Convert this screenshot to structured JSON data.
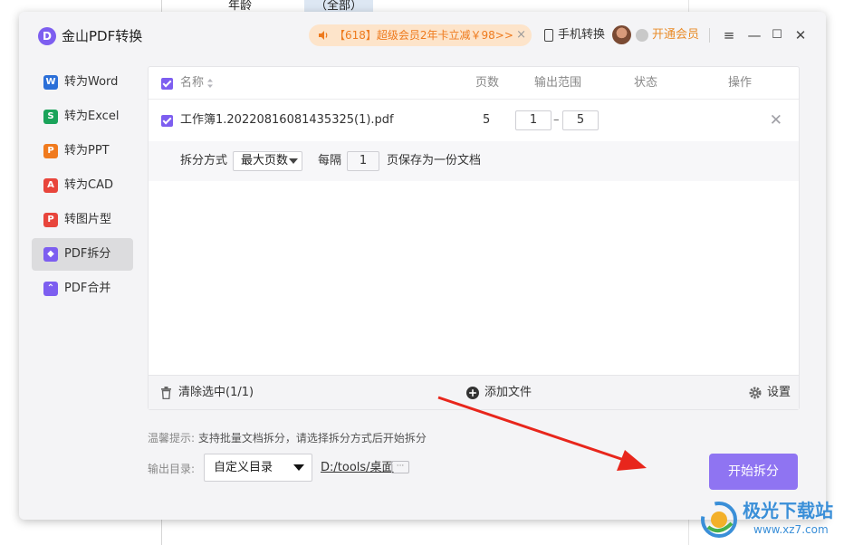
{
  "background": {
    "cell_age": "年龄",
    "cell_all": "（全部）"
  },
  "titlebar": {
    "app_title": "金山PDF转换",
    "logo_letter": "D",
    "promo_text": "【618】超级会员2年卡立减￥98>>",
    "promo_close": "×",
    "phone_label": "手机转换",
    "vip_label": "开通会员",
    "menu_icon": "≡",
    "minimize_icon": "—",
    "maximize_icon": "☐",
    "close_icon": "✕"
  },
  "sidebar": {
    "items": [
      {
        "label": "转为Word",
        "icon": "word-icon",
        "glyph": "W",
        "color": "#2b6fd8"
      },
      {
        "label": "转为Excel",
        "icon": "excel-icon",
        "glyph": "S",
        "color": "#1aa35a"
      },
      {
        "label": "转为PPT",
        "icon": "ppt-icon",
        "glyph": "P",
        "color": "#f07a1e"
      },
      {
        "label": "转为CAD",
        "icon": "cad-icon",
        "glyph": "A",
        "color": "#e8453c"
      },
      {
        "label": "转图片型PDF",
        "icon": "image-pdf-icon",
        "glyph": "P",
        "color": "#e8453c"
      },
      {
        "label": "PDF拆分",
        "icon": "split-icon",
        "glyph": "◆",
        "color": "#7d5ef0",
        "active": true
      },
      {
        "label": "PDF合并",
        "icon": "merge-icon",
        "glyph": "⌃",
        "color": "#7d5ef0"
      }
    ]
  },
  "table": {
    "headers": {
      "name": "名称",
      "pages": "页数",
      "range": "输出范围",
      "status": "状态",
      "action": "操作"
    },
    "file": {
      "name": "工作簿1.20220816081435325(1).pdf",
      "pages": "5",
      "range_from": "1",
      "range_dash": "–",
      "range_to": "5",
      "remove": "✕"
    },
    "split": {
      "method_label": "拆分方式",
      "method_value": "最大页数",
      "every_label": "每隔",
      "every_value": "1",
      "suffix": "页保存为一份文档"
    },
    "footer": {
      "clear_label": "清除选中(1/1)",
      "add_label": "添加文件",
      "settings_label": "设置"
    }
  },
  "bottom": {
    "hint_label": "温馨提示:",
    "hint_text": " 支持批量文档拆分，请选择拆分方式后开始拆分",
    "output_label": "输出目录:",
    "output_option": "自定义目录",
    "output_path": "D:/tools/桌面",
    "more_label": "···",
    "start_label": "开始拆分"
  },
  "watermark": {
    "title": "极光下载站",
    "url": "www.xz7.com"
  },
  "colors": {
    "accent": "#7d5ef0",
    "start_button": "#8f74f2",
    "promo_text": "#ee7a1d",
    "arrow": "#e8261c"
  }
}
